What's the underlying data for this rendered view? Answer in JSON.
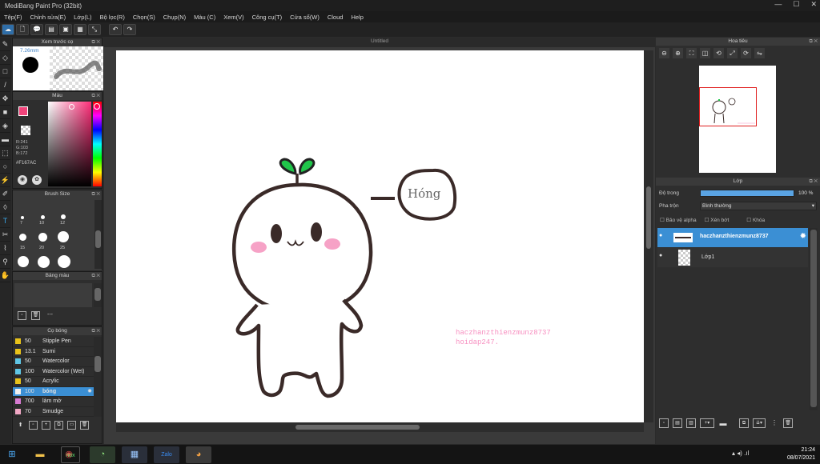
{
  "window": {
    "title": "MediBang Paint Pro (32bit)",
    "min": "—",
    "max": "☐",
    "close": "✕"
  },
  "menu": [
    "Tệp(F)",
    "Chỉnh sửa(E)",
    "Lớp(L)",
    "Bộ lọc(R)",
    "Chọn(S)",
    "Chụp(N)",
    "Màu (C)",
    "Xem(V)",
    "Công cụ(T)",
    "Cửa sổ(W)",
    "Cloud",
    "Help"
  ],
  "document": {
    "tab": "Untitled"
  },
  "brush_preview": {
    "title": "Xem trước cọ",
    "size": "7.26mm"
  },
  "color_panel": {
    "title": "Màu",
    "r": "R:241",
    "g": "G:103",
    "b": "B:172",
    "hex": "#F167AC",
    "current": "#f1437a"
  },
  "brush_size": {
    "title": "Brush Size",
    "sizes": [
      "7",
      "10",
      "12",
      "15",
      "20",
      "25"
    ]
  },
  "palette": {
    "title": "Bảng màu",
    "value": "---"
  },
  "brushes": {
    "title": "Cọ bóng",
    "items": [
      {
        "size": "50",
        "name": "Stipple Pen",
        "color": "#e8c21a"
      },
      {
        "size": "13.1",
        "name": "Sumi",
        "color": "#e8c21a"
      },
      {
        "size": "50",
        "name": "Watercolor",
        "color": "#5fc6e6"
      },
      {
        "size": "100",
        "name": "Watercolor (Wet)",
        "color": "#5fc6e6"
      },
      {
        "size": "50",
        "name": "Acrylic",
        "color": "#e8c21a"
      },
      {
        "size": "100",
        "name": "bóng",
        "color": "#f0f0f0",
        "selected": true
      },
      {
        "size": "700",
        "name": "làm mờ",
        "color": "#d77ad1"
      },
      {
        "size": "70",
        "name": "Smudge",
        "color": "#f1a8c5"
      }
    ]
  },
  "navigator": {
    "title": "Hoa tiêu"
  },
  "layers": {
    "title": "Lớp",
    "opacity_label": "Độ trong",
    "opacity_value": "100 %",
    "blend_label": "Pha trộn",
    "blend_value": "Bình thường",
    "protect_alpha": "Bảo vệ alpha",
    "clipping": "Xén bớt",
    "lock": "Khóa",
    "items": [
      {
        "name": "haczhanzthienzmunz8737",
        "selected": true
      },
      {
        "name": "Lớp1",
        "selected": false
      }
    ]
  },
  "canvas_text": {
    "bubble": "Hóng",
    "wm1": "haczhanzthienzmunz8737",
    "wm2": "hoidap247."
  },
  "taskbar": {
    "time": "21:24",
    "date": "08/07/2021"
  }
}
